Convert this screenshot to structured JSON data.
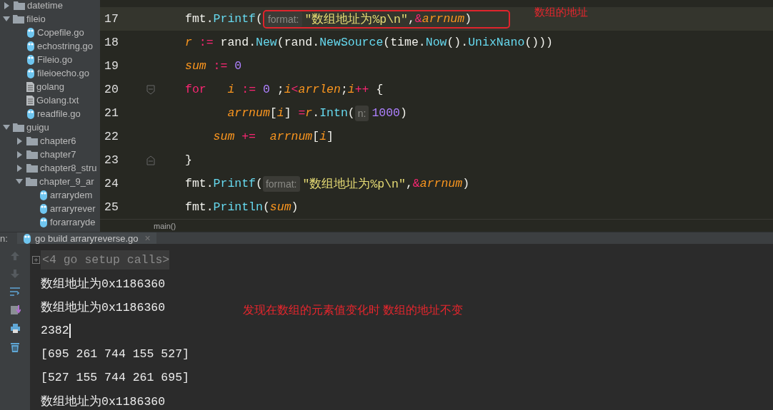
{
  "project_tree": [
    {
      "label": "datetime",
      "kind": "folder",
      "expanded": false
    },
    {
      "label": "fileio",
      "kind": "folder",
      "expanded": true,
      "children": [
        {
          "label": "Copefile.go",
          "kind": "go"
        },
        {
          "label": "echostring.go",
          "kind": "go"
        },
        {
          "label": "Fileio.go",
          "kind": "go"
        },
        {
          "label": "fileioecho.go",
          "kind": "go"
        },
        {
          "label": "golang",
          "kind": "text"
        },
        {
          "label": "Golang.txt",
          "kind": "text"
        },
        {
          "label": "readfile.go",
          "kind": "go"
        }
      ]
    },
    {
      "label": "guigu",
      "kind": "folder",
      "expanded": true,
      "children": [
        {
          "label": "chapter6",
          "kind": "folder",
          "expanded": false
        },
        {
          "label": "chapter7",
          "kind": "folder",
          "expanded": false
        },
        {
          "label": "chapter8_stru",
          "kind": "folder",
          "expanded": false
        },
        {
          "label": "chapter_9_ar",
          "kind": "folder",
          "expanded": true,
          "children": [
            {
              "label": "arrarydem",
              "kind": "go"
            },
            {
              "label": "arraryrever",
              "kind": "go"
            },
            {
              "label": "forarraryde",
              "kind": "go"
            }
          ]
        }
      ]
    }
  ],
  "editor": {
    "lines": [
      {
        "number": "17",
        "current": true,
        "annotation_box": true,
        "kind": "code",
        "tokens": [
          {
            "kind": "plain",
            "t": "fmt."
          },
          {
            "kind": "fn",
            "t": "Printf"
          },
          {
            "kind": "plain",
            "t": "("
          },
          {
            "kind": "hint",
            "t": "format:"
          },
          {
            "kind": "str",
            "t": "\"数组地址为%p\\n\""
          },
          {
            "kind": "plain",
            "t": ","
          },
          {
            "kind": "op",
            "t": "&"
          },
          {
            "kind": "var",
            "t": "arrnum"
          },
          {
            "kind": "plain",
            "t": ")"
          }
        ]
      },
      {
        "number": "18",
        "current": false,
        "annotation_box": false,
        "kind": "code",
        "tokens": [
          {
            "kind": "var",
            "t": "r"
          },
          {
            "kind": "op",
            "t": " :="
          },
          {
            "kind": "plain",
            "t": " rand."
          },
          {
            "kind": "fn",
            "t": "New"
          },
          {
            "kind": "plain",
            "t": "(rand."
          },
          {
            "kind": "fn",
            "t": "NewSource"
          },
          {
            "kind": "plain",
            "t": "(time."
          },
          {
            "kind": "fn",
            "t": "Now"
          },
          {
            "kind": "plain",
            "t": "()."
          },
          {
            "kind": "fn",
            "t": "UnixNano"
          },
          {
            "kind": "plain",
            "t": "()))"
          }
        ]
      },
      {
        "number": "19",
        "current": false,
        "annotation_box": false,
        "kind": "code",
        "tokens": [
          {
            "kind": "var",
            "t": "sum"
          },
          {
            "kind": "op",
            "t": " :="
          },
          {
            "kind": "num",
            "t": " 0"
          }
        ]
      },
      {
        "number": "20",
        "current": false,
        "annotation_box": false,
        "kind": "fold_start",
        "tokens": [
          {
            "kind": "kw",
            "t": "for"
          },
          {
            "kind": "var",
            "t": "   i"
          },
          {
            "kind": "op",
            "t": " :="
          },
          {
            "kind": "num",
            "t": " 0"
          },
          {
            "kind": "plain",
            "t": " ;"
          },
          {
            "kind": "var",
            "t": "i"
          },
          {
            "kind": "op",
            "t": "<"
          },
          {
            "kind": "var",
            "t": "arrlen"
          },
          {
            "kind": "plain",
            "t": ";"
          },
          {
            "kind": "var",
            "t": "i"
          },
          {
            "kind": "op",
            "t": "++"
          },
          {
            "kind": "plain",
            "t": " {"
          }
        ]
      },
      {
        "number": "21",
        "current": false,
        "annotation_box": false,
        "kind": "code",
        "tokens": [
          {
            "kind": "var",
            "t": "      arrnum"
          },
          {
            "kind": "plain",
            "t": "["
          },
          {
            "kind": "var",
            "t": "i"
          },
          {
            "kind": "plain",
            "t": "] "
          },
          {
            "kind": "op",
            "t": "="
          },
          {
            "kind": "var",
            "t": "r"
          },
          {
            "kind": "plain",
            "t": "."
          },
          {
            "kind": "fn",
            "t": "Intn"
          },
          {
            "kind": "plain",
            "t": "("
          },
          {
            "kind": "hint",
            "t": "n:"
          },
          {
            "kind": "num",
            "t": "1000"
          },
          {
            "kind": "plain",
            "t": ")"
          }
        ]
      },
      {
        "number": "22",
        "current": false,
        "annotation_box": false,
        "kind": "code",
        "tokens": [
          {
            "kind": "var",
            "t": "    sum"
          },
          {
            "kind": "op",
            "t": " +="
          },
          {
            "kind": "var",
            "t": "  arrnum"
          },
          {
            "kind": "plain",
            "t": "["
          },
          {
            "kind": "var",
            "t": "i"
          },
          {
            "kind": "plain",
            "t": "]"
          }
        ]
      },
      {
        "number": "23",
        "current": false,
        "annotation_box": false,
        "kind": "fold_end",
        "tokens": [
          {
            "kind": "plain",
            "t": "}"
          }
        ]
      },
      {
        "number": "24",
        "current": false,
        "annotation_box": false,
        "kind": "code",
        "tokens": [
          {
            "kind": "plain",
            "t": "fmt."
          },
          {
            "kind": "fn",
            "t": "Printf"
          },
          {
            "kind": "plain",
            "t": "("
          },
          {
            "kind": "hint",
            "t": "format:"
          },
          {
            "kind": "str",
            "t": "\"数组地址为%p\\n\""
          },
          {
            "kind": "plain",
            "t": ","
          },
          {
            "kind": "op",
            "t": "&"
          },
          {
            "kind": "var",
            "t": "arrnum"
          },
          {
            "kind": "plain",
            "t": ")"
          }
        ]
      },
      {
        "number": "25",
        "current": false,
        "annotation_box": false,
        "kind": "code",
        "tokens": [
          {
            "kind": "plain",
            "t": "fmt."
          },
          {
            "kind": "fn",
            "t": "Println"
          },
          {
            "kind": "plain",
            "t": "("
          },
          {
            "kind": "var",
            "t": "sum"
          },
          {
            "kind": "plain",
            "t": ")"
          }
        ]
      }
    ],
    "note": "数组的地址",
    "breadcrumb": "main()"
  },
  "run_panel": {
    "label": "n:",
    "tab": "go build arraryreverse.go",
    "close": "×",
    "output": [
      {
        "kind": "fold",
        "text": "<4 go setup calls>",
        "cursor": false
      },
      {
        "kind": "out",
        "text": "数组地址为0x1186360",
        "cursor": false
      },
      {
        "kind": "out",
        "text": "数组地址为0x1186360",
        "cursor": false
      },
      {
        "kind": "out",
        "text": "2382",
        "cursor": true
      },
      {
        "kind": "out",
        "text": "[695 261 744 155 527]",
        "cursor": false
      },
      {
        "kind": "out",
        "text": "[527 155 744 261 695]",
        "cursor": false
      },
      {
        "kind": "out",
        "text": "数组地址为0x1186360",
        "cursor": false
      }
    ],
    "note": "发现在数组的元素值变化时 数组的地址不变"
  }
}
